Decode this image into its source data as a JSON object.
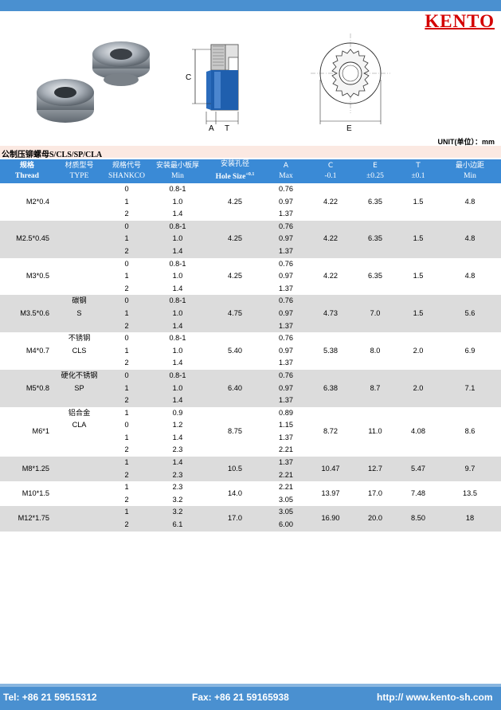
{
  "brand": {
    "logo": "KENTO"
  },
  "figure_labels": {
    "c": "C",
    "a": "A",
    "t": "T",
    "e": "E"
  },
  "unit": "UNIT(单位）：mm",
  "heading": "公制压铆螺母S/CLS/SP/CLA",
  "headers": [
    {
      "zh": "规格",
      "en": "Thread"
    },
    {
      "zh": "材质型号",
      "en": "TYPE"
    },
    {
      "zh": "规格代号",
      "en": "SHANKCO"
    },
    {
      "zh": "安装最小板厚",
      "en": "Min"
    },
    {
      "zh": "安装孔径",
      "en": "Hole Size",
      "sup": "+0.1"
    },
    {
      "zh": "A",
      "en": "Max"
    },
    {
      "zh": "C",
      "en": "-0.1"
    },
    {
      "zh": "E",
      "en": "±0.25"
    },
    {
      "zh": "T",
      "en": "±0.1"
    },
    {
      "zh": "最小边距",
      "en": "Min"
    }
  ],
  "type_labels": {
    "m3_5": {
      "zh": "碳钢",
      "en": "S"
    },
    "m4": {
      "zh": "不锈钢",
      "en": "CLS"
    },
    "m5": {
      "zh": "硬化不锈钢",
      "en": "SP"
    },
    "m6": {
      "zh": "铝合金",
      "en": "CLA"
    }
  },
  "rows": [
    {
      "thread": "M2*0.4",
      "codes": [
        "0",
        "1",
        "2"
      ],
      "min": [
        "0.8-1",
        "1.0",
        "1.4"
      ],
      "hole": "4.25",
      "a": [
        "0.76",
        "0.97",
        "1.37"
      ],
      "c": "4.22",
      "e": "6.35",
      "t": "1.5",
      "edge": "4.8"
    },
    {
      "thread": "M2.5*0.45",
      "codes": [
        "0",
        "1",
        "2"
      ],
      "min": [
        "0.8-1",
        "1.0",
        "1.4"
      ],
      "hole": "4.25",
      "a": [
        "0.76",
        "0.97",
        "1.37"
      ],
      "c": "4.22",
      "e": "6.35",
      "t": "1.5",
      "edge": "4.8"
    },
    {
      "thread": "M3*0.5",
      "codes": [
        "0",
        "1",
        "2"
      ],
      "min": [
        "0.8-1",
        "1.0",
        "1.4"
      ],
      "hole": "4.25",
      "a": [
        "0.76",
        "0.97",
        "1.37"
      ],
      "c": "4.22",
      "e": "6.35",
      "t": "1.5",
      "edge": "4.8"
    },
    {
      "thread": "M3.5*0.6",
      "codes": [
        "0",
        "1",
        "2"
      ],
      "min": [
        "0.8-1",
        "1.0",
        "1.4"
      ],
      "hole": "4.75",
      "a": [
        "0.76",
        "0.97",
        "1.37"
      ],
      "c": "4.73",
      "e": "7.0",
      "t": "1.5",
      "edge": "5.6"
    },
    {
      "thread": "M4*0.7",
      "codes": [
        "0",
        "1",
        "2"
      ],
      "min": [
        "0.8-1",
        "1.0",
        "1.4"
      ],
      "hole": "5.40",
      "a": [
        "0.76",
        "0.97",
        "1.37"
      ],
      "c": "5.38",
      "e": "8.0",
      "t": "2.0",
      "edge": "6.9"
    },
    {
      "thread": "M5*0.8",
      "codes": [
        "0",
        "1",
        "2"
      ],
      "min": [
        "0.8-1",
        "1.0",
        "1.4"
      ],
      "hole": "6.40",
      "a": [
        "0.76",
        "0.97",
        "1.37"
      ],
      "c": "6.38",
      "e": "8.7",
      "t": "2.0",
      "edge": "7.1"
    },
    {
      "thread": "M6*1",
      "codes": [
        "1",
        "0",
        "1",
        "2"
      ],
      "min": [
        "0.9",
        "1.2",
        "1.4",
        "2.3"
      ],
      "hole": "8.75",
      "a": [
        "0.89",
        "1.15",
        "1.37",
        "2.21"
      ],
      "c": "8.72",
      "e": "11.0",
      "t": "4.08",
      "edge": "8.6"
    },
    {
      "thread": "M8*1.25",
      "codes": [
        "1",
        "2"
      ],
      "min": [
        "1.4",
        "2.3"
      ],
      "hole": "10.5",
      "a": [
        "1.37",
        "2.21"
      ],
      "c": "10.47",
      "e": "12.7",
      "t": "5.47",
      "edge": "9.7"
    },
    {
      "thread": "M10*1.5",
      "codes": [
        "1",
        "2"
      ],
      "min": [
        "2.3",
        "3.2"
      ],
      "hole": "14.0",
      "a": [
        "2.21",
        "3.05"
      ],
      "c": "13.97",
      "e": "17.0",
      "t": "7.48",
      "edge": "13.5"
    },
    {
      "thread": "M12*1.75",
      "codes": [
        "1",
        "2"
      ],
      "min": [
        "3.2",
        "6.1"
      ],
      "hole": "17.0",
      "a": [
        "3.05",
        "6.00"
      ],
      "c": "16.90",
      "e": "20.0",
      "t": "8.50",
      "edge": "18"
    }
  ],
  "footer": {
    "tel": "Tel: +86 21 59515312",
    "fax": "Fax: +86 21 59165938",
    "web": "http:// www.kento-sh.com"
  }
}
